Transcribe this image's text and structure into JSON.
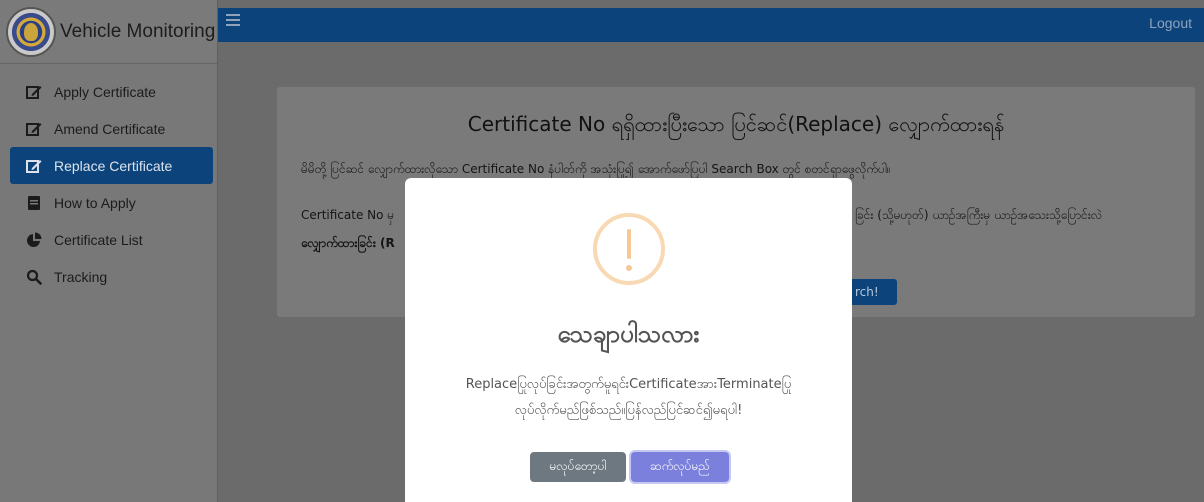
{
  "brand": {
    "title": "Vehicle Monitoring",
    "logo_icon": "emblem-logo"
  },
  "topbar": {
    "menu_icon": "hamburger-icon",
    "logout_label": "Logout",
    "background": "#0b437a"
  },
  "sidebar": {
    "items": [
      {
        "label": "Apply Certificate",
        "icon": "edit-icon",
        "active": false
      },
      {
        "label": "Amend Certificate",
        "icon": "edit-icon",
        "active": false
      },
      {
        "label": "Replace Certificate",
        "icon": "edit-icon",
        "active": true
      },
      {
        "label": "How to Apply",
        "icon": "document-icon",
        "active": false
      },
      {
        "label": "Certificate List",
        "icon": "pie-chart-icon",
        "active": false
      },
      {
        "label": "Tracking",
        "icon": "search-icon",
        "active": false
      }
    ]
  },
  "card": {
    "title": "Certificate No ရရှိထားပြီးသော ပြင်ဆင်(Replace) လျှောက်ထားရန်",
    "line1": "မိမိတို့ ပြင်ဆင် လျှောက်ထားလိုသော Certificate No နံပါတ်ကို အသုံးပြု၍ အောက်ဖော်ပြပါ Search Box တွင် စတင်ရှာဖွေလိုက်ပါ။",
    "line2_left": "Certificate No မှ",
    "line2_right": "ခြင်း (သို့မဟုတ်) ယာဉ်အကြီးမှ ယာဉ်အသေးသို့ပြောင်းလဲ",
    "line3": "လျှောက်ထားခြင်း (R",
    "search_label": "rch!"
  },
  "modal": {
    "icon": "warning-icon",
    "title": "သေချာပါသလား",
    "message_line1": "Replaceပြုလုပ်ခြင်းအတွက်မူရင်းCertificateအားTerminateပြု",
    "message_line2": "လုပ်လိုက်မည်ဖြစ်သည်။ပြန်လည်ပြင်ဆင်၍မရပါ!",
    "cancel_label": "မလုပ်တော့ပါ",
    "confirm_label": "ဆက်လုပ်မည်",
    "cancel_color": "#6e7881",
    "confirm_color": "#7a80db"
  }
}
